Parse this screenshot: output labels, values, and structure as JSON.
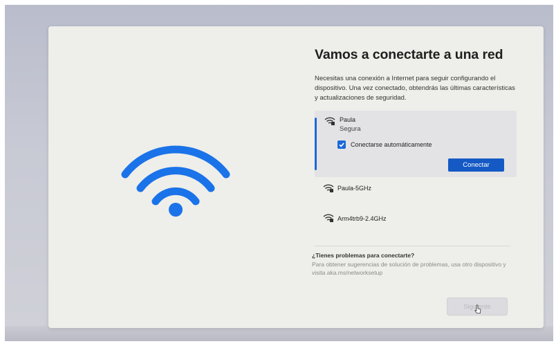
{
  "page": {
    "title": "Vamos a conectarte a una red",
    "description": "Necesitas una conexión a Internet para seguir configurando el dispositivo. Una vez conectado, obtendrás las últimas características y actualizaciones de seguridad."
  },
  "networks": {
    "selected": {
      "name": "Paula",
      "status": "Segura",
      "auto_connect_label": "Conectarse automáticamente",
      "auto_connect_checked": true,
      "connect_label": "Conectar"
    },
    "others": [
      {
        "name": "Paula-5GHz",
        "icon": "wifi-secured-icon"
      },
      {
        "name": "Arm4trb9-2.4GHz",
        "icon": "wifi-secured-icon"
      }
    ]
  },
  "help": {
    "title": "¿Tienes problemas para conectarte?",
    "text": "Para obtener sugerencias de solución de problemas, usa otro dispositivo y visita aka.ms/networksetup"
  },
  "footer": {
    "next_label": "Siguiente"
  },
  "colors": {
    "accent": "#1b68d8",
    "button": "#1559c4",
    "card_bg": "#eeeeea"
  }
}
